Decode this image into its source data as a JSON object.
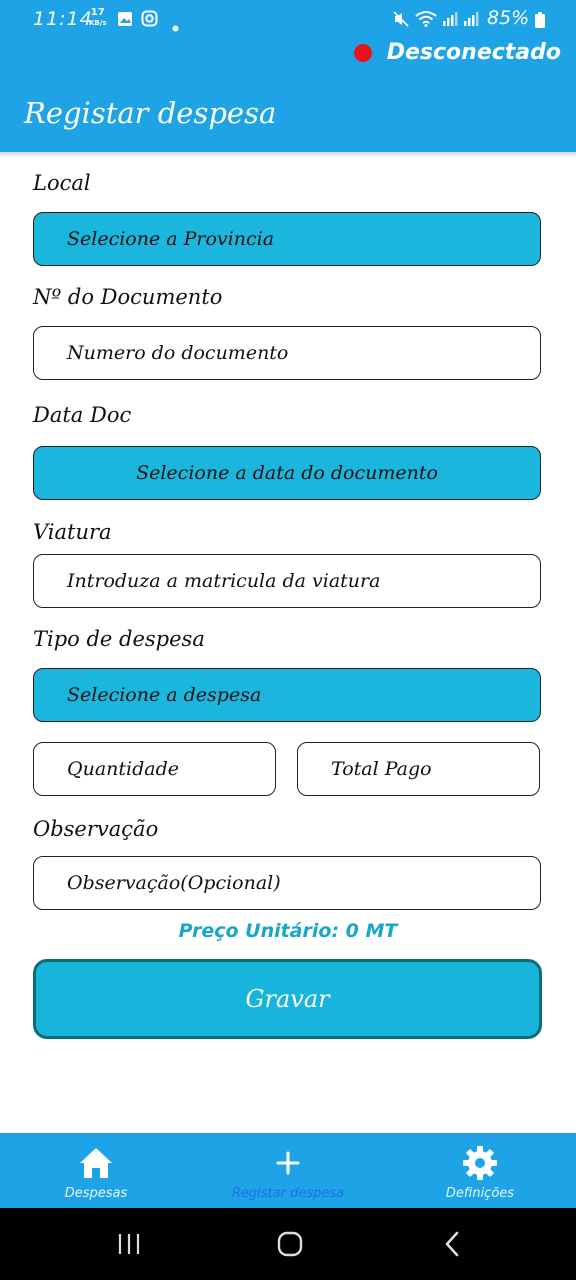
{
  "status_bar": {
    "time": "11:14",
    "net_speed_value": "17",
    "net_speed_unit": "KB/s",
    "battery": "85%"
  },
  "app_bar": {
    "connection_status": "Desconectado",
    "title": "Registar despesa"
  },
  "form": {
    "local_label": "Local",
    "local_value": "Selecione a Provincia",
    "doc_number_label": "Nº do Documento",
    "doc_number_placeholder": "Numero do documento",
    "doc_date_label": "Data Doc",
    "doc_date_value": "Selecione a data do documento",
    "vehicle_label": "Viatura",
    "vehicle_placeholder": "Introduza a matricula da viatura",
    "expense_type_label": "Tipo de despesa",
    "expense_type_value": "Selecione a despesa",
    "quantity_placeholder": "Quantidade",
    "total_paid_placeholder": "Total Pago",
    "observation_label": "Observação",
    "observation_placeholder": "Observação(Opcional)",
    "unit_price": "Preço Unitário: 0 MT",
    "save_label": "Gravar"
  },
  "bottom_nav": {
    "items": [
      {
        "label": "Despesas",
        "icon": "home-icon"
      },
      {
        "label": "Registar despesa",
        "icon": "plus-icon"
      },
      {
        "label": "Definições",
        "icon": "gear-icon"
      }
    ],
    "active_index": 1
  },
  "colors": {
    "primary": "#1ea3e6",
    "field_fill": "#1bb6dd",
    "status_dot": "#e8131d"
  }
}
